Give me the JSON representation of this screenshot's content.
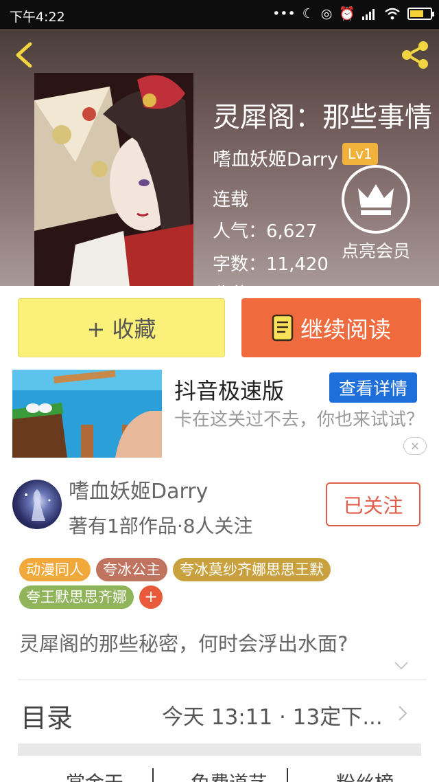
{
  "status_bar": {
    "time": "下午4:22",
    "icons": [
      "more-dots-icon",
      "moon-icon",
      "sync-icon",
      "alarm-icon",
      "signal-icon",
      "wifi-icon",
      "battery-icon"
    ]
  },
  "book": {
    "title": "灵犀阁：那些事情",
    "author": "嗜血妖姬Darry",
    "level": "Lv1",
    "status": "连载",
    "popularity": "人气：6,627",
    "word_count": "字数：11,420",
    "more": "收藏：",
    "vip_label": "点亮会员"
  },
  "actions": {
    "favorite": "+ 收藏",
    "continue_reading": "继续阅读"
  },
  "ad": {
    "title": "抖音极速版",
    "detail_button": "查看详情",
    "description": "卡在这关过不去，你也来试试？",
    "close": "✕"
  },
  "author_info": {
    "name": "嗜血妖姬Darry",
    "stats": "著有1部作品·8人关注",
    "follow_state": "已关注"
  },
  "tags": [
    {
      "label": "动漫同人",
      "color": "#f0a93a"
    },
    {
      "label": "夸冰公主",
      "color": "#c0735e"
    },
    {
      "label": "夸冰莫纱齐娜思思王默",
      "color": "#c9a13e"
    },
    {
      "label": "夸王默思思齐娜",
      "color": "#8fb45a"
    }
  ],
  "tag_add": "+",
  "synopsis": "灵犀阁的那些秘密，何时会浮出水面?",
  "toc": {
    "label": "目录",
    "latest": "今天 13:11 · 13定下..."
  },
  "bottom_tabs": [
    "赏金天",
    "免费道艺",
    "粉丝榜"
  ],
  "colors": {
    "accent_orange": "#ef6a3c",
    "favorite_yellow": "#fbf17a",
    "follow_red": "#e05c4b",
    "ad_blue": "#1e6fd9"
  }
}
